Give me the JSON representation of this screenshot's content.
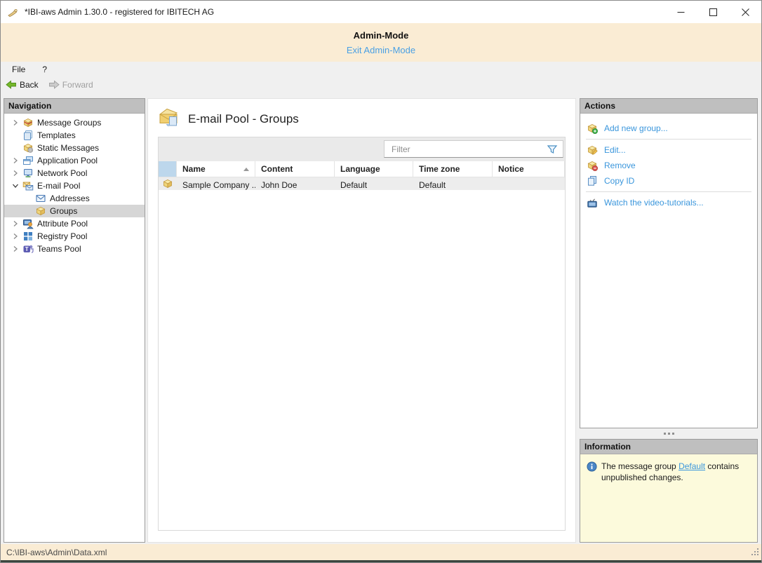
{
  "window": {
    "title": "*IBI-aws Admin 1.30.0 - registered for IBITECH AG",
    "controls": [
      "minimize",
      "maximize",
      "close"
    ]
  },
  "banner": {
    "title": "Admin-Mode",
    "exit_link": "Exit Admin-Mode"
  },
  "menubar": {
    "items": [
      "File",
      "?"
    ]
  },
  "toolbar": {
    "back": "Back",
    "forward": "Forward"
  },
  "navigation": {
    "header": "Navigation",
    "items": [
      {
        "label": "Message Groups",
        "icon": "message-groups-icon",
        "chevron": "collapsed",
        "level": 0,
        "selected": false
      },
      {
        "label": "Templates",
        "icon": "templates-icon",
        "chevron": "none",
        "level": 0,
        "selected": false
      },
      {
        "label": "Static Messages",
        "icon": "static-messages-icon",
        "chevron": "none",
        "level": 0,
        "selected": false
      },
      {
        "label": "Application Pool",
        "icon": "application-pool-icon",
        "chevron": "collapsed",
        "level": 0,
        "selected": false
      },
      {
        "label": "Network Pool",
        "icon": "network-pool-icon",
        "chevron": "collapsed",
        "level": 0,
        "selected": false
      },
      {
        "label": "E-mail Pool",
        "icon": "email-pool-icon",
        "chevron": "expanded",
        "level": 0,
        "selected": false
      },
      {
        "label": "Addresses",
        "icon": "addresses-icon",
        "chevron": "none",
        "level": 1,
        "selected": false
      },
      {
        "label": "Groups",
        "icon": "groups-icon",
        "chevron": "none",
        "level": 1,
        "selected": true
      },
      {
        "label": "Attribute Pool",
        "icon": "attribute-pool-icon",
        "chevron": "collapsed",
        "level": 0,
        "selected": false
      },
      {
        "label": "Registry Pool",
        "icon": "registry-pool-icon",
        "chevron": "collapsed",
        "level": 0,
        "selected": false
      },
      {
        "label": "Teams Pool",
        "icon": "teams-pool-icon",
        "chevron": "collapsed",
        "level": 0,
        "selected": false
      }
    ]
  },
  "main": {
    "title": "E-mail Pool - Groups",
    "title_icon": "email-pool-groups-icon",
    "filter": {
      "placeholder": "Filter",
      "value": ""
    },
    "table": {
      "columns": [
        "Name",
        "Content",
        "Language",
        "Time zone",
        "Notice"
      ],
      "sort_column": "Name",
      "sort_direction": "ascending",
      "rows": [
        {
          "icon": "groups-icon",
          "cells": [
            "Sample Company ...",
            "John Doe",
            "Default",
            "Default",
            ""
          ]
        }
      ]
    }
  },
  "actions": {
    "header": "Actions",
    "items": [
      {
        "label": "Add new group...",
        "icon": "add-group-icon",
        "group": 0
      },
      {
        "label": "Edit...",
        "icon": "edit-group-icon",
        "group": 1
      },
      {
        "label": "Remove",
        "icon": "remove-group-icon",
        "group": 1
      },
      {
        "label": "Copy ID",
        "icon": "copy-id-icon",
        "group": 1
      },
      {
        "label": "Watch the video-tutorials...",
        "icon": "video-tutorials-icon",
        "group": 2
      }
    ]
  },
  "information": {
    "header": "Information",
    "text_before": "The message group ",
    "link": "Default",
    "text_after": " contains unpublished changes."
  },
  "statusbar": {
    "path": "C:\\IBI-aws\\Admin\\Data.xml"
  },
  "colors": {
    "banner_bg": "#faecd4",
    "link_blue": "#3a96dc",
    "panel_header_bg": "#bfbfbf",
    "info_bg": "#fcfadc",
    "table_icon_header_bg": "#bdd7ec",
    "row_bg": "#ededed",
    "selected_tree_bg": "#d6d6d6",
    "back_arrow_green": "#76b82a"
  }
}
